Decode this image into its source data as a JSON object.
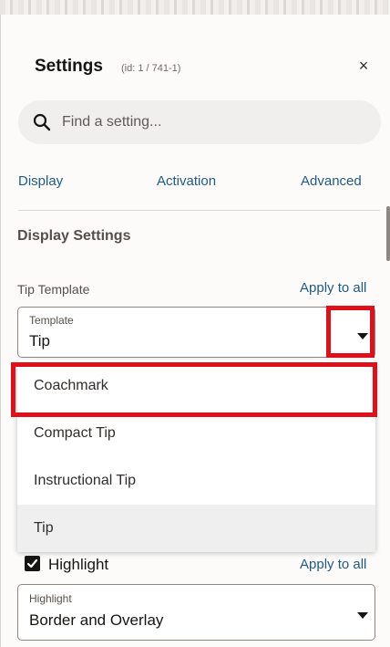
{
  "header": {
    "title": "Settings",
    "subtitle": "(id: 1 / 741-1)",
    "close_glyph": "×"
  },
  "search": {
    "placeholder": "Find a setting..."
  },
  "tabs": [
    {
      "label": "Display"
    },
    {
      "label": "Activation"
    },
    {
      "label": "Advanced"
    }
  ],
  "section": {
    "title": "Display Settings"
  },
  "tip_template": {
    "label": "Tip Template",
    "apply_all": "Apply to all",
    "select_label": "Template",
    "value": "Tip",
    "options": [
      "Coachmark",
      "Compact Tip",
      "Instructional Tip",
      "Tip"
    ],
    "selected_option": "Tip",
    "highlighted_option": "Coachmark"
  },
  "highlight": {
    "checkbox_label": "Highlight",
    "checked": true,
    "apply_all": "Apply to all",
    "select_label": "Highlight",
    "value": "Border and Overlay"
  },
  "colors": {
    "link": "#1f5b85",
    "annotation_red": "#e0101a",
    "search_bg": "#f1efed"
  },
  "icons": {
    "search": "search-icon",
    "close": "close-icon",
    "caret": "chevron-down-icon",
    "check": "checkmark-icon"
  }
}
